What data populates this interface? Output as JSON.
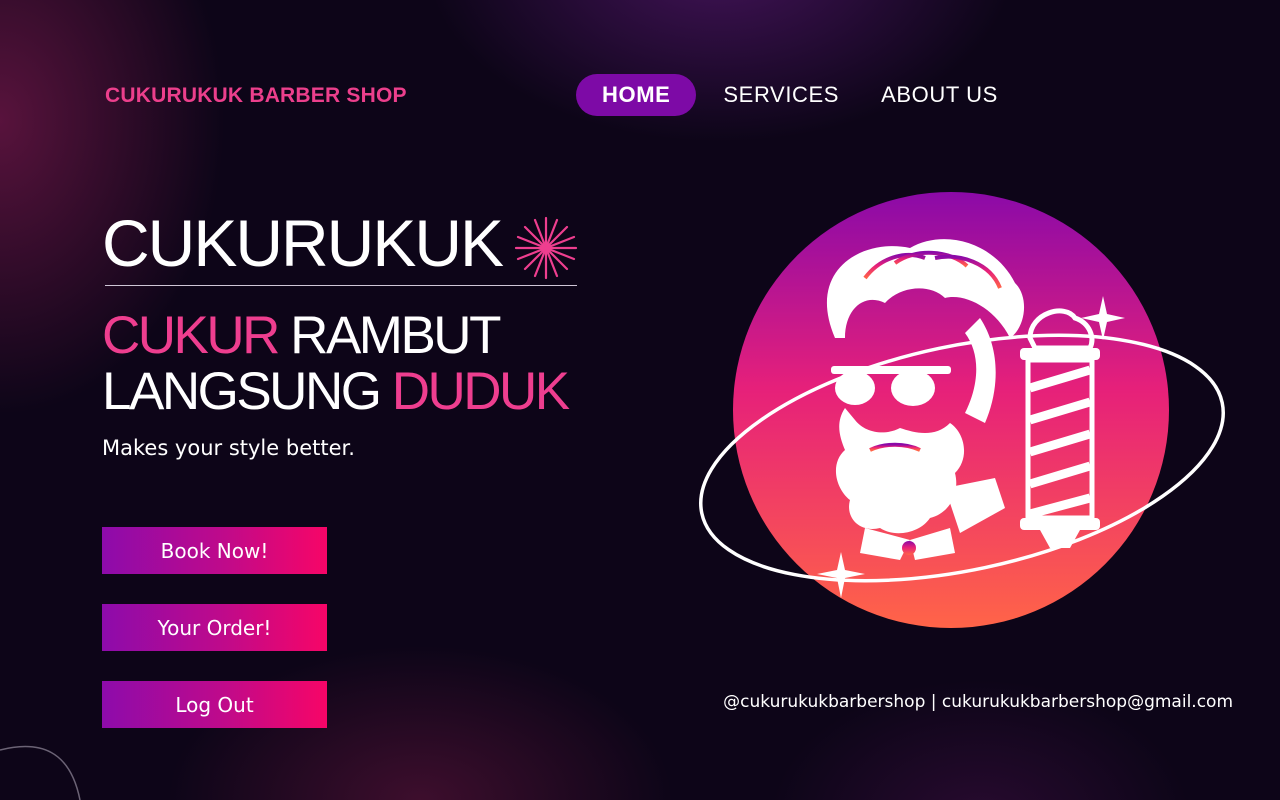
{
  "brand": "CUKURUKUK BARBER SHOP",
  "nav": {
    "home": "HOME",
    "services": "SERVICES",
    "about": "ABOUT US"
  },
  "hero": {
    "title": "CUKURUKUK",
    "tagline_part1": "CUKUR",
    "tagline_part2": " RAMBUT",
    "tagline_part3": "LANGSUNG ",
    "tagline_part4": "DUDUK",
    "subtitle": "Makes your style better."
  },
  "buttons": {
    "book": "Book Now!",
    "order": "Your Order!",
    "logout": "Log Out"
  },
  "contact": "@cukurukukbarbershop | cukurukukbarbershop@gmail.com",
  "colors": {
    "accent_pink": "#ee3e8f",
    "nav_active": "#7d0aa6",
    "background": "#0d0518"
  },
  "icons": [
    "starburst-icon",
    "barber-logo-icon",
    "sparkle-icon"
  ]
}
